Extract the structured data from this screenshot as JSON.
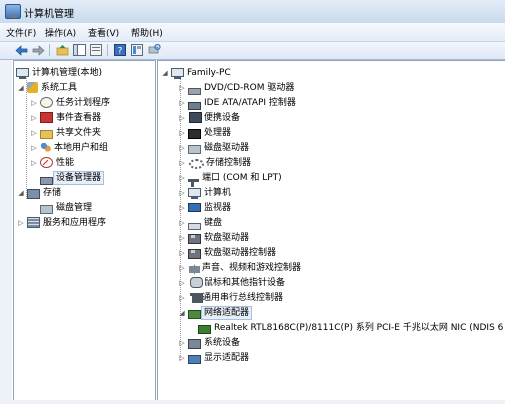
{
  "window": {
    "title": "计算机管理"
  },
  "menu": [
    {
      "label": "文件(F)"
    },
    {
      "label": "操作(A)"
    },
    {
      "label": "查看(V)"
    },
    {
      "label": "帮助(H)"
    }
  ],
  "toolbar": [
    {
      "icon": "back-arrow-icon"
    },
    {
      "icon": "forward-arrow-icon"
    },
    {
      "icon": "up-folder-icon"
    },
    {
      "icon": "show-hide-tree-icon"
    },
    {
      "icon": "properties-icon"
    },
    {
      "icon": "help-icon"
    },
    {
      "icon": "view-icon"
    },
    {
      "icon": "scan-hardware-icon"
    }
  ],
  "left_tree": {
    "root": "计算机管理(本地)",
    "system_tools": "系统工具",
    "task_scheduler": "任务计划程序",
    "event_viewer": "事件查看器",
    "shared_folders": "共享文件夹",
    "local_users": "本地用户和组",
    "performance": "性能",
    "device_manager": "设备管理器",
    "storage": "存储",
    "disk_management": "磁盘管理",
    "services_apps": "服务和应用程序"
  },
  "device_tree": {
    "computer": "Family-PC",
    "categories": [
      {
        "label": "DVD/CD-ROM 驱动器",
        "icon": "dvd-icon"
      },
      {
        "label": "IDE ATA/ATAPI 控制器",
        "icon": "ide-icon"
      },
      {
        "label": "便携设备",
        "icon": "portable-device-icon"
      },
      {
        "label": "处理器",
        "icon": "processor-icon"
      },
      {
        "label": "磁盘驱动器",
        "icon": "disk-drive-icon"
      },
      {
        "label": "存储控制器",
        "icon": "storage-controller-icon"
      },
      {
        "label": "端口 (COM 和 LPT)",
        "icon": "port-icon"
      },
      {
        "label": "计算机",
        "icon": "computer-icon"
      },
      {
        "label": "监视器",
        "icon": "monitor-icon"
      },
      {
        "label": "键盘",
        "icon": "keyboard-icon"
      },
      {
        "label": "软盘驱动器",
        "icon": "floppy-drive-icon"
      },
      {
        "label": "软盘驱动器控制器",
        "icon": "floppy-controller-icon"
      },
      {
        "label": "声音、视频和游戏控制器",
        "icon": "sound-icon"
      },
      {
        "label": "鼠标和其他指针设备",
        "icon": "mouse-icon"
      },
      {
        "label": "通用串行总线控制器",
        "icon": "usb-icon"
      },
      {
        "label": "网络适配器",
        "icon": "network-adapter-icon"
      },
      {
        "label": "系统设备",
        "icon": "system-device-icon"
      },
      {
        "label": "显示适配器",
        "icon": "display-adapter-icon"
      }
    ],
    "network_child": "Realtek RTL8168C(P)/8111C(P) 系列 PCI-E 千兆以太网 NIC (NDIS 6"
  }
}
